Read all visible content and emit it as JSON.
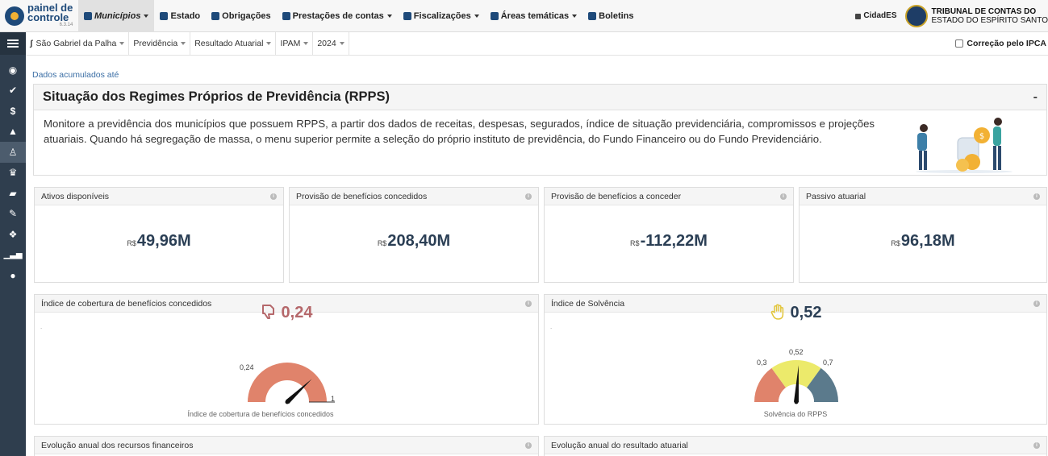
{
  "app": {
    "logo_line1": "painel de",
    "logo_line2": "controle",
    "version": "6.3.14"
  },
  "nav": {
    "items": [
      {
        "label": "Municípios",
        "dropdown": true,
        "active": true,
        "italic": true
      },
      {
        "label": "Estado",
        "dropdown": false
      },
      {
        "label": "Obrigações",
        "dropdown": false
      },
      {
        "label": "Prestações de contas",
        "dropdown": true
      },
      {
        "label": "Fiscalizações",
        "dropdown": true
      },
      {
        "label": "Áreas temáticas",
        "dropdown": true
      },
      {
        "label": "Boletins",
        "dropdown": false
      }
    ],
    "cidades": "CidadES",
    "tce_line1": "TRIBUNAL DE CONTAS DO",
    "tce_line2": "ESTADO DO ESPÍRITO SANTO"
  },
  "filters": {
    "municipio": "São Gabriel da Palha",
    "area": "Previdência",
    "relatorio": "Resultado Atuarial",
    "instituto": "IPAM",
    "ano": "2024",
    "ipca_label": "Correção pelo IPCA"
  },
  "dados_label": "Dados acumulados até",
  "rpps": {
    "title": "Situação dos Regimes Próprios de Previdência (RPPS)",
    "collapse": "-",
    "description": "Monitore a previdência dos municípios que possuem RPPS, a partir dos dados de receitas, despesas, segurados, índice de situação previdenciária, compromissos e projeções atuariais. Quando há segregação de massa, o menu superior permite a seleção do próprio instituto de previdência, do Fundo Financeiro ou do Fundo Previdenciário."
  },
  "kpis": [
    {
      "title": "Ativos disponíveis",
      "currency": "R$",
      "value": "49,96M"
    },
    {
      "title": "Provisão de benefícios concedidos",
      "currency": "R$",
      "value": "208,40M"
    },
    {
      "title": "Provisão de benefícios a conceder",
      "currency": "R$",
      "value": "-112,22M"
    },
    {
      "title": "Passivo atuarial",
      "currency": "R$",
      "value": "96,18M"
    }
  ],
  "gauges": {
    "cobertura": {
      "title": "Índice de cobertura de benefícios concedidos",
      "value": "0,24",
      "numeric": 0.24,
      "min_label": "",
      "max_label": "1",
      "value_label": "0,24",
      "caption": "Índice de cobertura de benefícios concedidos",
      "color": "#e0836b",
      "value_color": "#b5686b",
      "icon": "thumbs-down-icon"
    },
    "solvencia": {
      "title": "Índice de Solvência",
      "value": "0,52",
      "numeric": 0.52,
      "low_label": "0,3",
      "high_label": "0,7",
      "value_label": "0,52",
      "caption": "Solvência do RPPS",
      "colors": [
        "#e0836b",
        "#ecea6b",
        "#5b7a8c"
      ],
      "value_color": "#2b3f55",
      "icon": "hand-stop-icon"
    }
  },
  "bottom_panels": [
    {
      "title": "Evolução anual dos recursos financeiros"
    },
    {
      "title": "Evolução anual do resultado atuarial"
    }
  ]
}
